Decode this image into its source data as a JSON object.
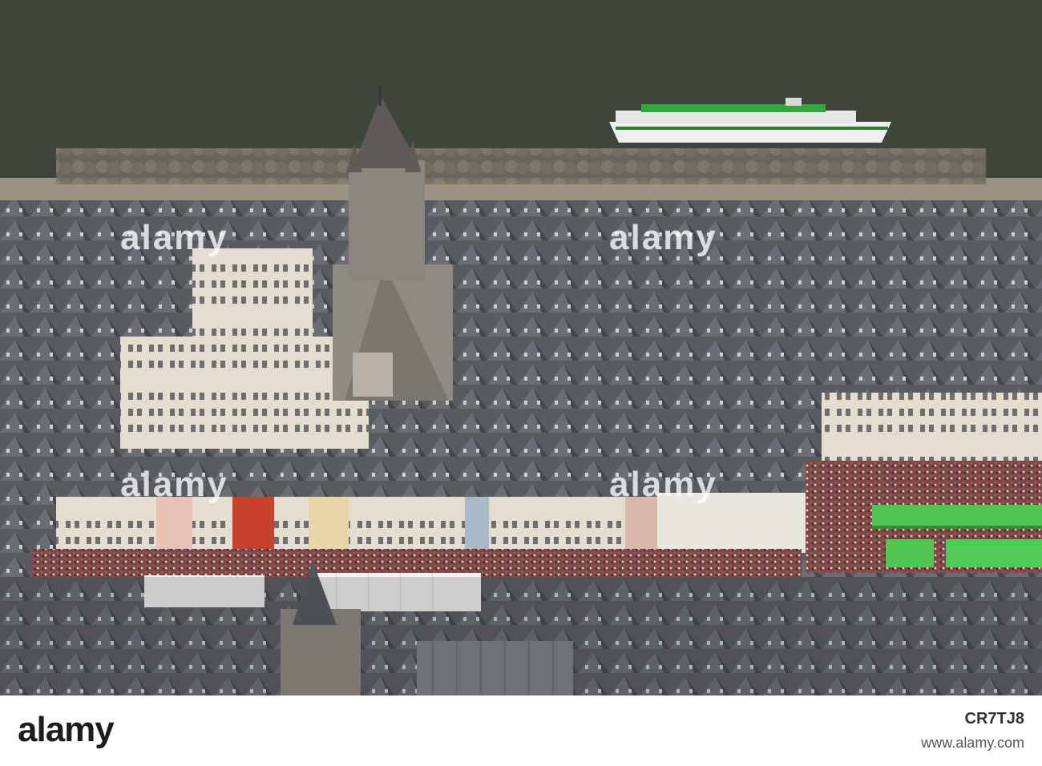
{
  "photo": {
    "subject": "aerial view of riverside old town with church tower, boat and crowded square"
  },
  "watermark": {
    "text": "alamy",
    "color": "#ffffff"
  },
  "footer": {
    "logo_text": "alamy",
    "image_id": "CR7TJ8",
    "site": "www.alamy.com"
  },
  "colors": {
    "river": "#3c4338",
    "roof": "#5a5d62",
    "facade": "#d9d3c7",
    "tent": "#47c24a",
    "boat": "#f2f2f2"
  }
}
